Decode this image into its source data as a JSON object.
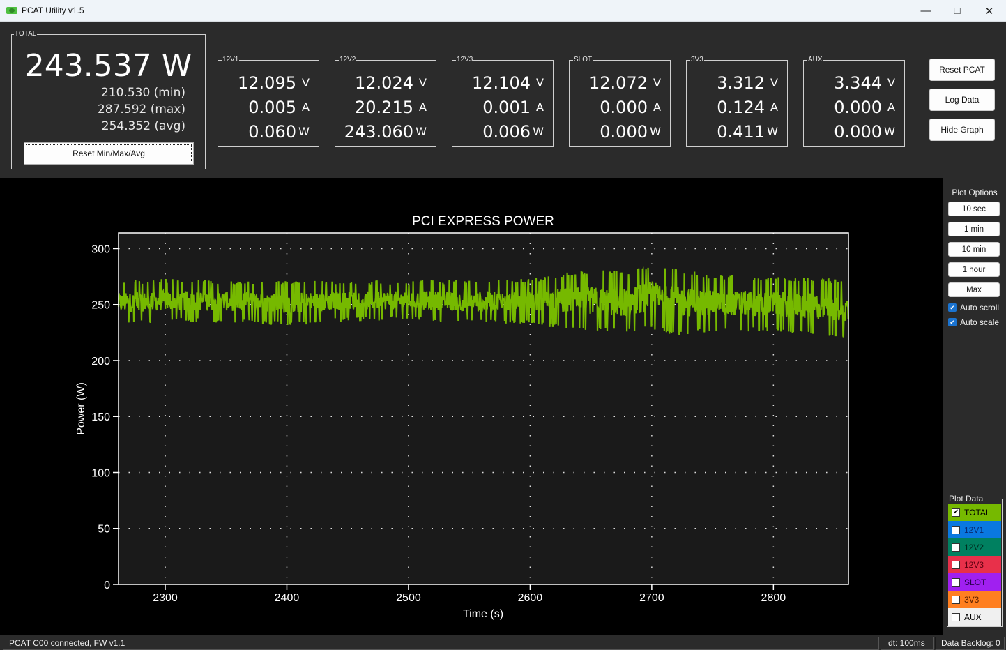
{
  "window": {
    "title": "PCAT Utility v1.5",
    "minimize_glyph": "—",
    "maximize_glyph": "□",
    "close_glyph": "✕"
  },
  "total": {
    "label": "TOTAL",
    "value": "243.537 W",
    "min": "210.530 (min)",
    "max": "287.592 (max)",
    "avg": "254.352 (avg)",
    "reset_button": "Reset Min/Max/Avg"
  },
  "rails": [
    {
      "label": "12V1",
      "volts": "12.095",
      "amps": "0.005",
      "watts": "0.060"
    },
    {
      "label": "12V2",
      "volts": "12.024",
      "amps": "20.215",
      "watts": "243.060"
    },
    {
      "label": "12V3",
      "volts": "12.104",
      "amps": "0.001",
      "watts": "0.006"
    },
    {
      "label": "SLOT",
      "volts": "12.072",
      "amps": "0.000",
      "watts": "0.000"
    },
    {
      "label": "3V3",
      "volts": "3.312",
      "amps": "0.124",
      "watts": "0.411"
    },
    {
      "label": "AUX",
      "volts": "3.344",
      "amps": "0.000",
      "watts": "0.000"
    }
  ],
  "units": {
    "volts": "V",
    "amps": "A",
    "watts": "W"
  },
  "actions": {
    "reset_pcat": "Reset PCAT",
    "log_data": "Log Data",
    "hide_graph": "Hide Graph"
  },
  "plot_options": {
    "title": "Plot Options",
    "buttons": [
      "10 sec",
      "1 min",
      "10 min",
      "1 hour",
      "Max"
    ],
    "auto_scroll": {
      "label": "Auto scroll",
      "checked": true
    },
    "auto_scale": {
      "label": "Auto scale",
      "checked": true
    },
    "check_glyph": "✔"
  },
  "plot_data": {
    "title": "Plot Data",
    "items": [
      {
        "label": "TOTAL",
        "checked": true,
        "color": "#76b900",
        "text_color": "#000000"
      },
      {
        "label": "12V1",
        "checked": false,
        "color": "#0a78e0",
        "text_color": "#0a2a70"
      },
      {
        "label": "12V2",
        "checked": false,
        "color": "#008060",
        "text_color": "#002a1e"
      },
      {
        "label": "12V3",
        "checked": false,
        "color": "#e8304a",
        "text_color": "#5a0010"
      },
      {
        "label": "SLOT",
        "checked": false,
        "color": "#a020f0",
        "text_color": "#2a0050"
      },
      {
        "label": "3V3",
        "checked": false,
        "color": "#ff7f20",
        "text_color": "#5a2000"
      },
      {
        "label": "AUX",
        "checked": false,
        "color": "#f0f0f0",
        "text_color": "#000000"
      }
    ]
  },
  "status": {
    "connection": "PCAT C00 connected, FW v1.1",
    "dt": "dt: 100ms",
    "backlog": "Data Backlog: 0"
  },
  "chart_data": {
    "type": "line",
    "title": "PCI EXPRESS POWER",
    "xlabel": "Time (s)",
    "ylabel": "Power (W)",
    "xlim": [
      2261.6,
      2861.7
    ],
    "ylim": [
      0,
      314
    ],
    "xticks": [
      2300,
      2400,
      2500,
      2600,
      2700,
      2800
    ],
    "yticks": [
      0,
      50,
      100,
      150,
      200,
      250,
      300
    ],
    "grid": true,
    "line_color": "#76b900",
    "series": [
      {
        "name": "TOTAL",
        "sample_interval_s": 0.1,
        "summary": {
          "mean": 254.4,
          "typical_low": 238,
          "typical_high": 270,
          "min_visible": 210.5,
          "max_visible": 287.6
        },
        "envelope": {
          "x": [
            2262,
            2300,
            2350,
            2400,
            2450,
            2500,
            2550,
            2600,
            2630,
            2650,
            2680,
            2700,
            2720,
            2750,
            2800,
            2861
          ],
          "low": [
            232,
            234,
            234,
            231,
            235,
            236,
            233,
            232,
            228,
            226,
            224,
            228,
            222,
            226,
            226,
            220
          ],
          "high": [
            271,
            273,
            272,
            272,
            272,
            272,
            272,
            273,
            279,
            281,
            280,
            287,
            283,
            276,
            276,
            272
          ]
        }
      }
    ]
  }
}
